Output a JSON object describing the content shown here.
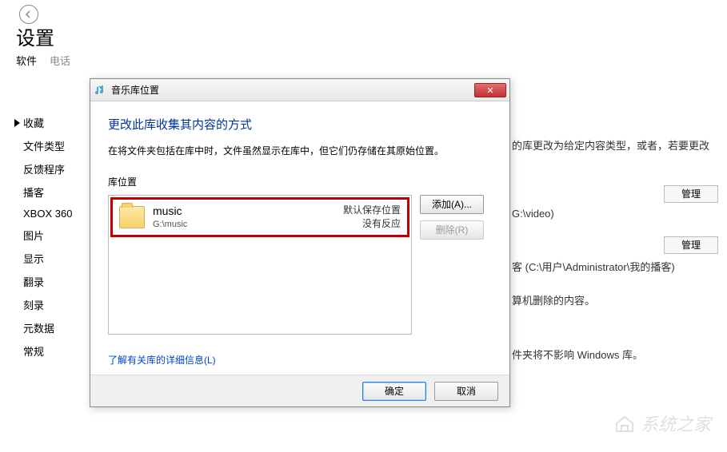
{
  "header": {
    "settings_title": "设置",
    "tab_software": "软件",
    "tab_phone": "电话"
  },
  "sidebar": {
    "items": [
      {
        "label": "收藏",
        "selected": true
      },
      {
        "label": "文件类型"
      },
      {
        "label": "反馈程序"
      },
      {
        "label": "播客"
      },
      {
        "label": "XBOX 360"
      },
      {
        "label": "图片"
      },
      {
        "label": "显示"
      },
      {
        "label": "翻录"
      },
      {
        "label": "刻录"
      },
      {
        "label": "元数据"
      },
      {
        "label": "常规"
      }
    ]
  },
  "background": {
    "line1": "的库更改为给定内容类型，或者，若要更改",
    "manage1": "管理",
    "video_path": "G:\\video)",
    "manage2": "管理",
    "podcast_path": "客 (C:\\用户\\Administrator\\我的播客)",
    "deleted": "算机删除的内容。",
    "library_note": "件夹将不影响 Windows 库。"
  },
  "dialog": {
    "title": "音乐库位置",
    "heading": "更改此库收集其内容的方式",
    "description": "在将文件夹包括在库中时，文件虽然显示在库中，但它们仍存储在其原始位置。",
    "section_label": "库位置",
    "folder": {
      "name": "music",
      "path": "G:\\music",
      "status1": "默认保存位置",
      "status2": "没有反应"
    },
    "buttons": {
      "add": "添加(A)...",
      "remove": "删除(R)",
      "ok": "确定",
      "cancel": "取消"
    },
    "link": "了解有关库的详细信息(L)"
  },
  "watermark": "系统之家"
}
